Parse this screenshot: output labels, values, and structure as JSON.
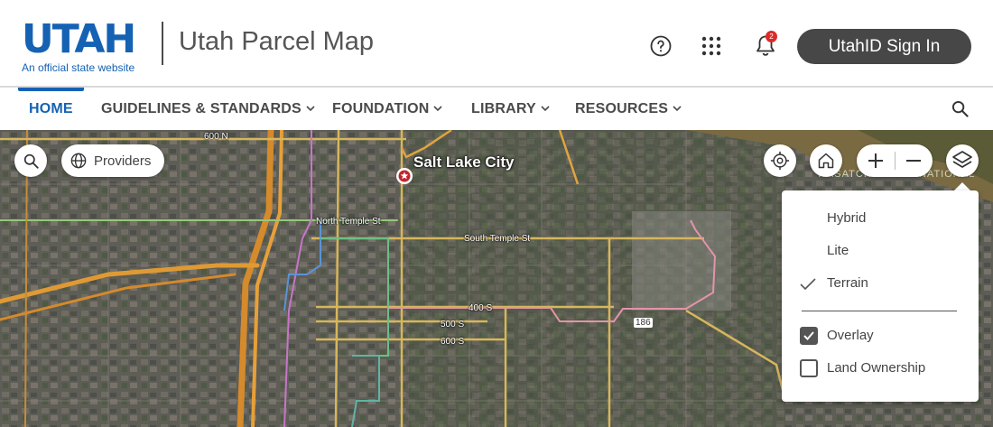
{
  "header": {
    "logo_word": "UTAH",
    "logo_tagline": "An official state website",
    "site_title": "Utah Parcel Map",
    "help_icon": "question-circle-icon",
    "apps_icon": "grid-dots-icon",
    "notifications_icon": "bell-icon",
    "notification_count": "2",
    "signin_label": "UtahID Sign In",
    "brand_color": "#1561b3"
  },
  "nav": {
    "items": [
      {
        "label": "HOME",
        "active": true
      },
      {
        "label": "GUIDELINES & STANDARDS",
        "dropdown": true
      },
      {
        "label": "FOUNDATION",
        "dropdown": true
      },
      {
        "label": "LIBRARY",
        "dropdown": true
      },
      {
        "label": "RESOURCES",
        "dropdown": true
      }
    ],
    "search_icon": "search-icon"
  },
  "map": {
    "providers_label": "Providers",
    "city_label": "Salt Lake City",
    "street_labels": {
      "north_600": "600 N",
      "north_temple": "North Temple St",
      "south_temple": "South Temple St",
      "s400": "400 S",
      "s500": "500 S",
      "s600": "600 S",
      "route": "186"
    },
    "terrain_label": "WASATCH-CACHE NATIONAL",
    "controls": [
      "search-icon",
      "globe-icon",
      "locate-icon",
      "home-icon",
      "zoom-in-icon",
      "zoom-out-icon",
      "layers-icon"
    ]
  },
  "layers": {
    "basemaps": [
      {
        "label": "Hybrid",
        "selected": false
      },
      {
        "label": "Lite",
        "selected": false
      },
      {
        "label": "Terrain",
        "selected": true
      }
    ],
    "overlays": [
      {
        "label": "Overlay",
        "checked": true
      },
      {
        "label": "Land Ownership",
        "checked": false
      }
    ]
  }
}
